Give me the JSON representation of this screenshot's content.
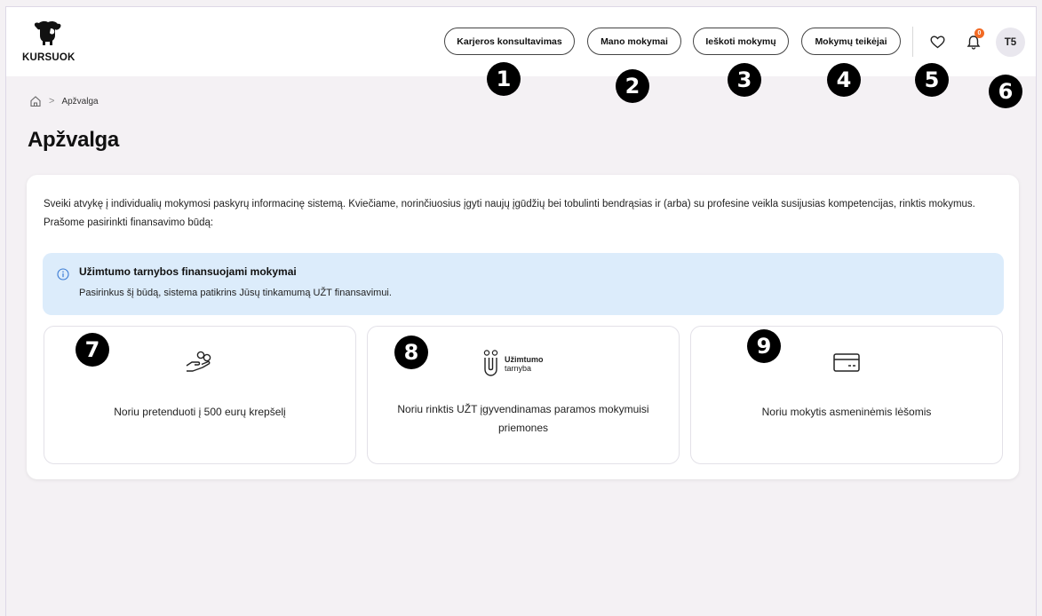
{
  "header": {
    "logo_text": "KURSUOK",
    "nav": [
      {
        "label": "Karjeros konsultavimas"
      },
      {
        "label": "Mano mokymai"
      },
      {
        "label": "Ieškoti mokymų"
      },
      {
        "label": "Mokymų teikėjai"
      }
    ],
    "favorites_icon": "heart-icon",
    "notifications_icon": "bell-icon",
    "notification_count": "0",
    "avatar_initials": "T5"
  },
  "markers": [
    "1",
    "2",
    "3",
    "4",
    "5",
    "6",
    "7",
    "8",
    "9"
  ],
  "breadcrumb": {
    "home_icon": "home-icon",
    "separator": ">",
    "current": "Apžvalga"
  },
  "page_title": "Apžvalga",
  "intro_text": "Sveiki atvykę į individualių mokymosi paskyrų informacinę sistemą. Kviečiame, norinčiuosius įgyti naujų įgūdžių bei tobulinti bendrąsias ir (arba) su profesine veikla susijusias kompetencijas, rinktis mokymus. Prašome pasirinkti finansavimo būdą:",
  "info": {
    "title": "Užimtumo tarnybos finansuojami mokymai",
    "text": "Pasirinkus šį būdą, sistema patikrins Jūsų tinkamumą UŽT finansavimui."
  },
  "cards": [
    {
      "label": "Noriu pretenduoti į 500 eurų krepšelį",
      "icon": "coin-hand-icon"
    },
    {
      "label": "Noriu rinktis UŽT įgyvendinamas paramos mokymuisi priemones",
      "icon": "uzt-logo-icon",
      "logo_line1": "Užimtumo",
      "logo_line2": "tarnyba"
    },
    {
      "label": "Noriu mokytis asmeninėmis lėšomis",
      "icon": "card-icon"
    }
  ],
  "colors": {
    "page_bg": "#f4f1f4",
    "info_bg": "#dcecfb",
    "badge": "#f26a24"
  }
}
